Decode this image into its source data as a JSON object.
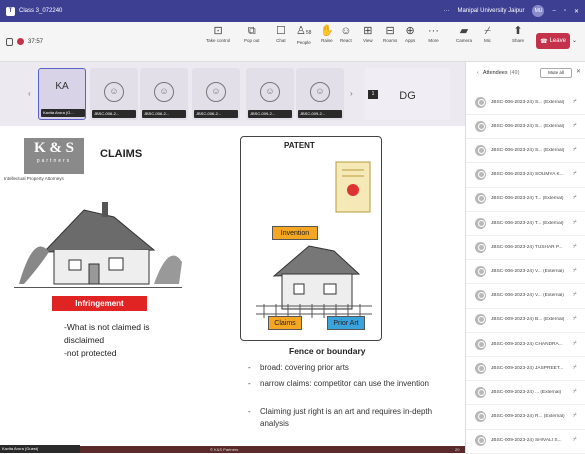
{
  "window": {
    "title": "Class 3_072240",
    "org": "Manipal University Jaipur",
    "org_avatar": "MU",
    "minimize": "–",
    "maximize": "▫",
    "close": "✕"
  },
  "meeting": {
    "timer": "37:57",
    "toolbar": {
      "take_control": "Take control",
      "pop_out": "Pop out",
      "chat": "Chat",
      "people": "People",
      "people_count": "58",
      "raise": "Raise",
      "react": "React",
      "view": "View",
      "rooms": "Rooms",
      "apps": "Apps",
      "more": "More",
      "camera": "Camera",
      "mic": "Mic",
      "share": "Share",
      "leave": "Leave"
    }
  },
  "video_strip": {
    "tiles": [
      {
        "initials": "KA",
        "name": "Kavita Arora (G..."
      },
      {
        "name": "JBSC-006-2..."
      },
      {
        "name": "JBSC-006-2..."
      },
      {
        "name": "JBSC-006-2..."
      },
      {
        "name": "JBSC-009-2..."
      },
      {
        "name": "JBSC-009-2..."
      }
    ],
    "dg_initials": "DG",
    "dg_badge": "1"
  },
  "slide": {
    "logo_main": "K & S",
    "logo_sub": "partners",
    "logo_tag": "Intellectual Property Attorneys",
    "left_title": "CLAIMS",
    "infringement": "Infringement",
    "left_lines": [
      "-What is not claimed is",
      "disclaimed",
      "-not protected"
    ],
    "patent_title": "PATENT",
    "callout_invention": "Invention",
    "callout_claims": "Claims",
    "callout_prior_art": "Prior Art",
    "fence_title": "Fence or boundary",
    "bullets": [
      "broad: covering prior arts",
      "narrow claims: competitor can use the invention",
      "Claiming just right is an art and requires in-depth analysis"
    ],
    "footer": "© K&S Partners",
    "page": "20",
    "presenter": "Kavita Arora (Guest)"
  },
  "attendees": {
    "title": "Attendees",
    "count": "(49)",
    "mute_all": "Mute all",
    "list": [
      "JBSC-006-2023-24) S... (External)",
      "JBSC-006-2023-24) S... (External)",
      "JBSC-006-2023-24) S... (External)",
      "JBSC-006-2023-24) SOUMYA K...",
      "JBSC-006-2023-24) T... (External)",
      "JBSC-006-2023-24) T... (External)",
      "JBSC-006-2023-24) TUSHAR P...",
      "JBSC-006-2023-24) V... (External)",
      "JBSC-006-2023-24) V... (External)",
      "JBSC-009-2023-24) B... (External)",
      "JBSC-009-2023-24) CHANDRA...",
      "JBSC-009-2023-24) JASPREET...",
      "JBSC-009-2023-24) ... (External)",
      "JBSC-009-2023-24) R... (External)",
      "JBSC-009-2023-24) SHIVALI S..."
    ]
  },
  "colors": {
    "titlebar": "#3d3f93",
    "leave": "#c4314b",
    "infringement": "#e02424",
    "invention_callout": "#f5a623",
    "claims_callout": "#f5a623",
    "prior_art_callout": "#3ba3dc"
  }
}
